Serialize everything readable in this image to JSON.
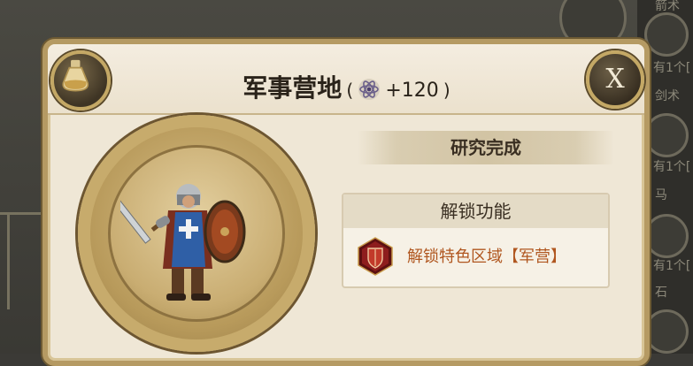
{
  "dialog": {
    "title": "军事营地",
    "paren_open": "(",
    "reward_value": "+120",
    "paren_close": ")",
    "close_label": "X",
    "research_status": "研究完成",
    "unlock_header": "解锁功能",
    "unlock_items": [
      {
        "label": "解锁特色区域【军营】",
        "icon": "red-shield-icon"
      }
    ]
  },
  "background": {
    "right_labels": [
      "箭术",
      "有1个[",
      "剑术",
      "有1个[",
      "马",
      "有1个[",
      "石"
    ]
  },
  "colors": {
    "panel": "#efe7d6",
    "frame_gold": "#b59a63",
    "unlock_text": "#b0561f",
    "shield_red": "#8e1d1d"
  }
}
